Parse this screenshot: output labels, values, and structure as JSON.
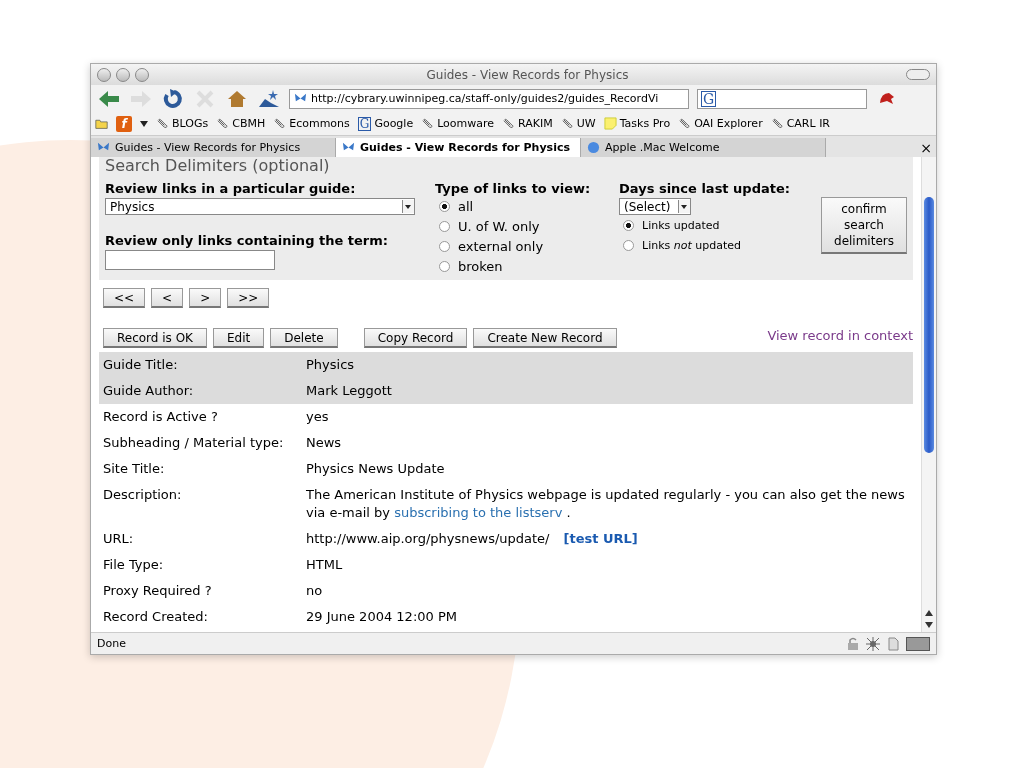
{
  "window": {
    "title": "Guides - View Records for Physics"
  },
  "address": {
    "value": "http://cybrary.uwinnipeg.ca/staff-only/guides2/guides_RecordVi"
  },
  "search_box": {
    "logo": "G"
  },
  "feed_icon": "f",
  "tab_close": "×",
  "bookmarks": [
    {
      "label": "BLOGs",
      "kind": "link"
    },
    {
      "label": "CBMH",
      "kind": "link"
    },
    {
      "label": "Ecommons",
      "kind": "link"
    },
    {
      "label": "Google",
      "kind": "google",
      "logo": "G"
    },
    {
      "label": "Loomware",
      "kind": "link"
    },
    {
      "label": "RAKIM",
      "kind": "link"
    },
    {
      "label": "UW",
      "kind": "link"
    },
    {
      "label": "Tasks Pro",
      "kind": "note"
    },
    {
      "label": "OAI Explorer",
      "kind": "link"
    },
    {
      "label": "CARL IR",
      "kind": "link"
    }
  ],
  "tabs": [
    {
      "label": "Guides - View Records for Physics",
      "selected": false,
      "kind": "guide"
    },
    {
      "label": "Guides - View Records for Physics",
      "selected": true,
      "kind": "guide"
    },
    {
      "label": "Apple .Mac Welcome",
      "selected": false,
      "kind": "globe"
    }
  ],
  "search": {
    "heading": "Search Delimiters (optional)",
    "guide_label": "Review links in a particular guide:",
    "guide_value": "Physics",
    "term_label": "Review only links containing the term:",
    "type_label": "Type of links to view:",
    "types": [
      {
        "label": "all",
        "selected": true
      },
      {
        "label": "U. of W. only",
        "selected": false
      },
      {
        "label": "external only",
        "selected": false
      },
      {
        "label": "broken",
        "selected": false
      }
    ],
    "days_label": "Days since last update:",
    "days_value": "(Select)",
    "updated": [
      {
        "label": "Links updated",
        "selected": true
      },
      {
        "label": "Links *not* updated",
        "selected": false
      }
    ],
    "confirm": "confirm search delimiters"
  },
  "nav_buttons": [
    "<<",
    "<",
    ">",
    ">>"
  ],
  "action_buttons": [
    "Record is OK",
    "Edit",
    "Delete",
    "Copy Record",
    "Create New Record"
  ],
  "context_link": "View record in context",
  "record": [
    {
      "label": "Guide Title:",
      "value": "Physics",
      "shaded": true
    },
    {
      "label": "Guide Author:",
      "value": "Mark Leggott",
      "shaded": true
    },
    {
      "label": "Record is Active ?",
      "value": "yes",
      "shaded": false
    },
    {
      "label": "Subheading / Material type:",
      "value": "News",
      "shaded": false
    },
    {
      "label": "Site Title:",
      "value": "Physics News Update",
      "shaded": false
    },
    {
      "label": "Description:",
      "value": "The American Institute of Physics webpage is updated regularly - you can also get the news via e-mail by",
      "link": "subscribing to the listserv",
      "after": " .",
      "shaded": false
    },
    {
      "label": "URL:",
      "value": "http://www.aip.org/physnews/update/",
      "test_link": "[test URL]",
      "shaded": false
    },
    {
      "label": "File Type:",
      "value": "HTML",
      "shaded": false
    },
    {
      "label": "Proxy Required ?",
      "value": "no",
      "shaded": false
    },
    {
      "label": "Record Created:",
      "value": "29 June 2004 12:00 PM",
      "shaded": false
    }
  ],
  "status_bar": {
    "text": "Done"
  }
}
